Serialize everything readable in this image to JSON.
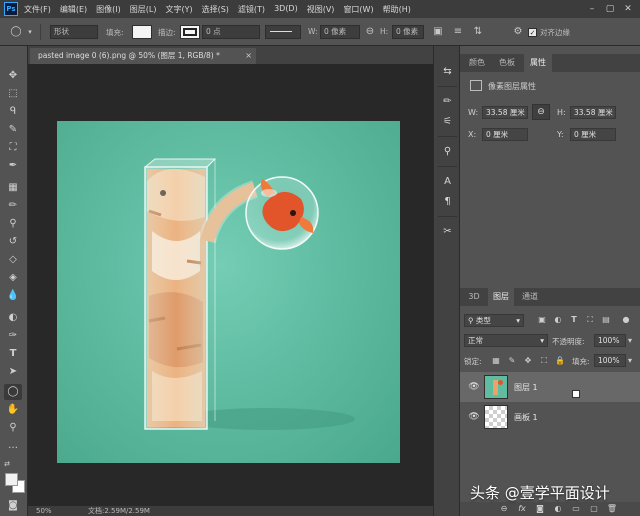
{
  "app": {
    "logo": "Ps",
    "menu": [
      "文件(F)",
      "编辑(E)",
      "图像(I)",
      "图层(L)",
      "文字(Y)",
      "选择(S)",
      "滤镜(T)",
      "3D(D)",
      "视图(V)",
      "窗口(W)",
      "帮助(H)"
    ],
    "window_controls": [
      "–",
      "▢",
      "✕"
    ]
  },
  "options_bar": {
    "shape_mode": "形状",
    "fill_label": "填充:",
    "stroke_label": "描边:",
    "stroke_width": "0 点",
    "w_label": "W:",
    "w_value": "0 像素",
    "h_label": "H:",
    "h_value": "0 像素",
    "align_edges_label": "对齐边缘",
    "align_edges_checked": true
  },
  "document": {
    "tab_title": "pasted image 0 (6).png @ 50% (图层 1, RGB/8) *",
    "close": "×",
    "zoom": "50%",
    "doc_size": "文档:2.59M/2.59M"
  },
  "properties_panel": {
    "tabs": [
      "颜色",
      "色板",
      "属性"
    ],
    "active_tab": "属性",
    "header": "像素图层属性",
    "w_label": "W:",
    "w_value": "33.58 厘米",
    "h_label": "H:",
    "h_value": "33.58 厘米",
    "x_label": "X:",
    "x_value": "0 厘米",
    "y_label": "Y:",
    "y_value": "0 厘米"
  },
  "layers_panel": {
    "tabs": [
      "3D",
      "图层",
      "通道"
    ],
    "active_tab": "图层",
    "filter_kind": "类型",
    "blend_mode": "正常",
    "opacity_label": "不透明度:",
    "opacity_value": "100%",
    "lock_label": "锁定:",
    "fill_label": "填充:",
    "fill_value": "100%",
    "layers": [
      {
        "name": "图层 1",
        "selected": true
      },
      {
        "name": "画板 1",
        "selected": false
      }
    ],
    "footer_icons": [
      "link-icon",
      "fx-icon",
      "mask-icon",
      "adjustment-icon",
      "folder-icon",
      "new-layer-icon",
      "trash-icon"
    ]
  },
  "watermark": "头条 @壹学平面设计",
  "colors": {
    "ui_dark": "#282828",
    "panel": "#535353",
    "canvas_background": "#5fbca1",
    "selection": "#686868"
  }
}
